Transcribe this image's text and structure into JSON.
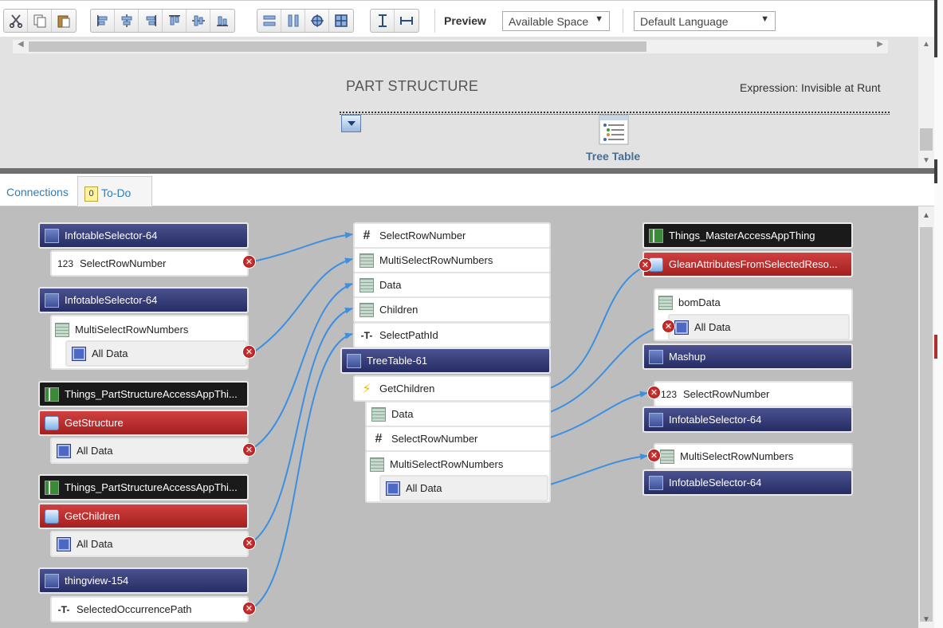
{
  "toolbar": {
    "buttons": [
      "cut-icon",
      "copy-icon",
      "paste-icon",
      "align-left-icon",
      "align-center-icon",
      "align-right-icon",
      "align-top-icon",
      "align-middle-icon",
      "align-bottom-icon",
      "distribute-horizontal-icon",
      "distribute-vertical-icon",
      "center-icon",
      "grid-icon",
      "same-height-icon",
      "same-width-icon"
    ],
    "preview_label": "Preview",
    "space_select": "Available Space",
    "language_select": "Default Language"
  },
  "canvas": {
    "part_title": "PART STRUCTURE",
    "expression": "Expression: Invisible at Runt",
    "tree_table_label": "Tree Table"
  },
  "tabs": {
    "connections": "Connections",
    "todo_count": "0",
    "todo": "To-Do"
  },
  "left": {
    "n1": "InfotableSelector-64",
    "n1_field": "SelectRowNumber",
    "n1_field_icon": "123",
    "n2": "InfotableSelector-64",
    "n2_field": "MultiSelectRowNumbers",
    "n2_sub": "All Data",
    "n3_thing": "Things_PartStructureAccessAppThi...",
    "n3_service": "GetStructure",
    "n3_sub": "All Data",
    "n4_thing": "Things_PartStructureAccessAppThi...",
    "n4_service": "GetChildren",
    "n4_sub": "All Data",
    "n5": "thingview-154",
    "n5_field": "SelectedOccurrencePath"
  },
  "middle": {
    "p1": "SelectRowNumber",
    "p2": "MultiSelectRowNumbers",
    "p3": "Data",
    "p4": "Children",
    "p5": "SelectPathId",
    "widget": "TreeTable-61",
    "event": "GetChildren",
    "o1": "Data",
    "o2": "SelectRowNumber",
    "o3": "MultiSelectRowNumbers",
    "o3_sub": "All Data"
  },
  "right": {
    "thing": "Things_MasterAccessAppThing",
    "service": "GleanAttributesFromSelectedReso...",
    "bom": "bomData",
    "bom_sub": "All Data",
    "mashup": "Mashup",
    "sel1_field": "SelectRowNumber",
    "sel1_icon": "123",
    "sel1": "InfotableSelector-64",
    "sel2_field": "MultiSelectRowNumbers",
    "sel2": "InfotableSelector-64"
  },
  "colors": {
    "wire": "#3d8fe0",
    "error": "#c62828",
    "widget_header": "#2f3770"
  }
}
